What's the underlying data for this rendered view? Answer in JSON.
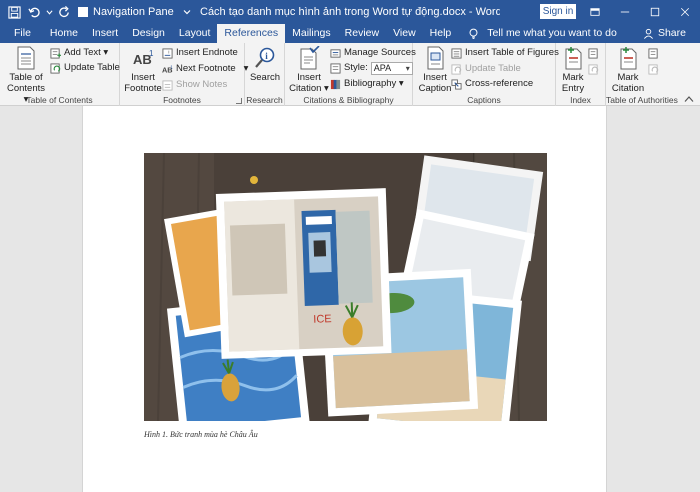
{
  "titlebar": {
    "nav_pane_label": "Navigation Pane",
    "doc_title": "Cách tạo danh mục hình ảnh trong Word tự động.docx  -  Word",
    "sign_in": "Sign in"
  },
  "tabs": [
    {
      "label": "File"
    },
    {
      "label": "Home"
    },
    {
      "label": "Insert"
    },
    {
      "label": "Design"
    },
    {
      "label": "Layout"
    },
    {
      "label": "References"
    },
    {
      "label": "Mailings"
    },
    {
      "label": "Review"
    },
    {
      "label": "View"
    },
    {
      "label": "Help"
    }
  ],
  "active_tab": "References",
  "tell_me": "Tell me what you want to do",
  "share": "Share",
  "ribbon": {
    "toc": {
      "label": "Table of Contents",
      "big_line1": "Table of",
      "big_line2": "Contents",
      "add_text": "Add Text",
      "update_table": "Update Table"
    },
    "footnotes": {
      "label": "Footnotes",
      "insert_line1": "Insert",
      "insert_line2": "Footnote",
      "insert_endnote": "Insert Endnote",
      "next_footnote": "Next Footnote",
      "show_notes": "Show Notes"
    },
    "research": {
      "label": "Research",
      "search": "Search"
    },
    "citations": {
      "label": "Citations & Bibliography",
      "insert_line1": "Insert",
      "insert_line2": "Citation",
      "manage_sources": "Manage Sources",
      "style_label": "Style:",
      "style_value": "APA",
      "bibliography": "Bibliography"
    },
    "captions": {
      "label": "Captions",
      "insert_line1": "Insert",
      "insert_line2": "Caption",
      "insert_tof": "Insert Table of Figures",
      "update_table": "Update Table",
      "cross_reference": "Cross-reference"
    },
    "index": {
      "label": "Index",
      "mark_line1": "Mark",
      "mark_line2": "Entry"
    },
    "authorities": {
      "label": "Table of Authorities",
      "mark_line1": "Mark",
      "mark_line2": "Citation"
    }
  },
  "document": {
    "caption": "Hình 1. Bức tranh mùa hè Châu Âu"
  },
  "colors": {
    "word_blue": "#2b579a",
    "ribbon_bg": "#f3f3f3"
  }
}
